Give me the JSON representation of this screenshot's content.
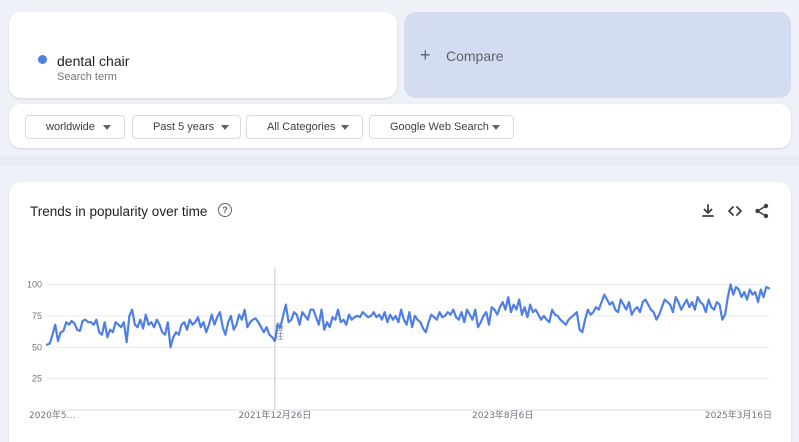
{
  "search_term": {
    "name": "dental chair",
    "subtitle": "Search term",
    "color": "#4f7fe3"
  },
  "compare": {
    "label": "Compare"
  },
  "filters": [
    {
      "label": "worldwide"
    },
    {
      "label": "Past 5 years"
    },
    {
      "label": "All Categories"
    },
    {
      "label": "Google Web Search"
    }
  ],
  "card": {
    "title": "Trends in popularity over time",
    "help_icon": "help-circle-icon",
    "tools": [
      "download-icon",
      "embed-code-icon",
      "share-icon"
    ]
  },
  "chart_data": {
    "type": "line",
    "ylim": [
      0,
      110
    ],
    "yticks": [
      25,
      50,
      75,
      100
    ],
    "grid": true,
    "legend": "none",
    "annotation": {
      "label": "备注",
      "x_index": 83
    },
    "x_tick_labels": [
      {
        "label": "2020年5…",
        "x_index": 0
      },
      {
        "label": "2021年12月26日",
        "x_index": 83
      },
      {
        "label": "2023年8月6日",
        "x_index": 166
      },
      {
        "label": "2025年3月16日",
        "x_index": 249
      }
    ],
    "series": [
      {
        "color": "#4f7fe3",
        "values": [
          52,
          53,
          60,
          68,
          55,
          62,
          63,
          70,
          68,
          71,
          69,
          64,
          63,
          71,
          72,
          70,
          70,
          68,
          72,
          62,
          60,
          70,
          58,
          64,
          62,
          70,
          68,
          66,
          70,
          54,
          75,
          80,
          68,
          66,
          72,
          65,
          76,
          68,
          70,
          66,
          72,
          68,
          62,
          60,
          70,
          50,
          58,
          62,
          60,
          68,
          70,
          64,
          72,
          68,
          70,
          74,
          66,
          70,
          62,
          68,
          76,
          68,
          74,
          78,
          66,
          60,
          70,
          75,
          64,
          68,
          76,
          72,
          80,
          66,
          70,
          72,
          73,
          70,
          66,
          62,
          66,
          60,
          58,
          55,
          68,
          66,
          75,
          84,
          70,
          72,
          78,
          76,
          68,
          78,
          75,
          72,
          80,
          80,
          74,
          68,
          80,
          64,
          70,
          66,
          74,
          72,
          80,
          70,
          72,
          68,
          76,
          72,
          74,
          75,
          74,
          78,
          76,
          74,
          75,
          78,
          74,
          76,
          72,
          78,
          70,
          76,
          72,
          75,
          70,
          80,
          72,
          68,
          78,
          66,
          75,
          72,
          70,
          65,
          62,
          70,
          76,
          74,
          72,
          78,
          74,
          75,
          78,
          76,
          80,
          74,
          72,
          78,
          70,
          80,
          76,
          72,
          80,
          66,
          70,
          75,
          78,
          68,
          82,
          80,
          76,
          82,
          86,
          80,
          90,
          78,
          84,
          80,
          88,
          76,
          82,
          74,
          84,
          78,
          80,
          76,
          72,
          75,
          72,
          70,
          80,
          76,
          75,
          72,
          70,
          68,
          72,
          74,
          76,
          78,
          64,
          62,
          72,
          80,
          76,
          78,
          82,
          80,
          86,
          92,
          88,
          84,
          86,
          80,
          78,
          88,
          84,
          80,
          86,
          76,
          80,
          82,
          78,
          86,
          88,
          84,
          80,
          78,
          72,
          76,
          82,
          88,
          86,
          84,
          78,
          90,
          86,
          80,
          84,
          88,
          82,
          86,
          80,
          90,
          86,
          84,
          78,
          88,
          82,
          80,
          86,
          84,
          72,
          76,
          90,
          100,
          92,
          98,
          96,
          90,
          94,
          88,
          96,
          92,
          94,
          86,
          96,
          90,
          98,
          97
        ]
      }
    ]
  }
}
